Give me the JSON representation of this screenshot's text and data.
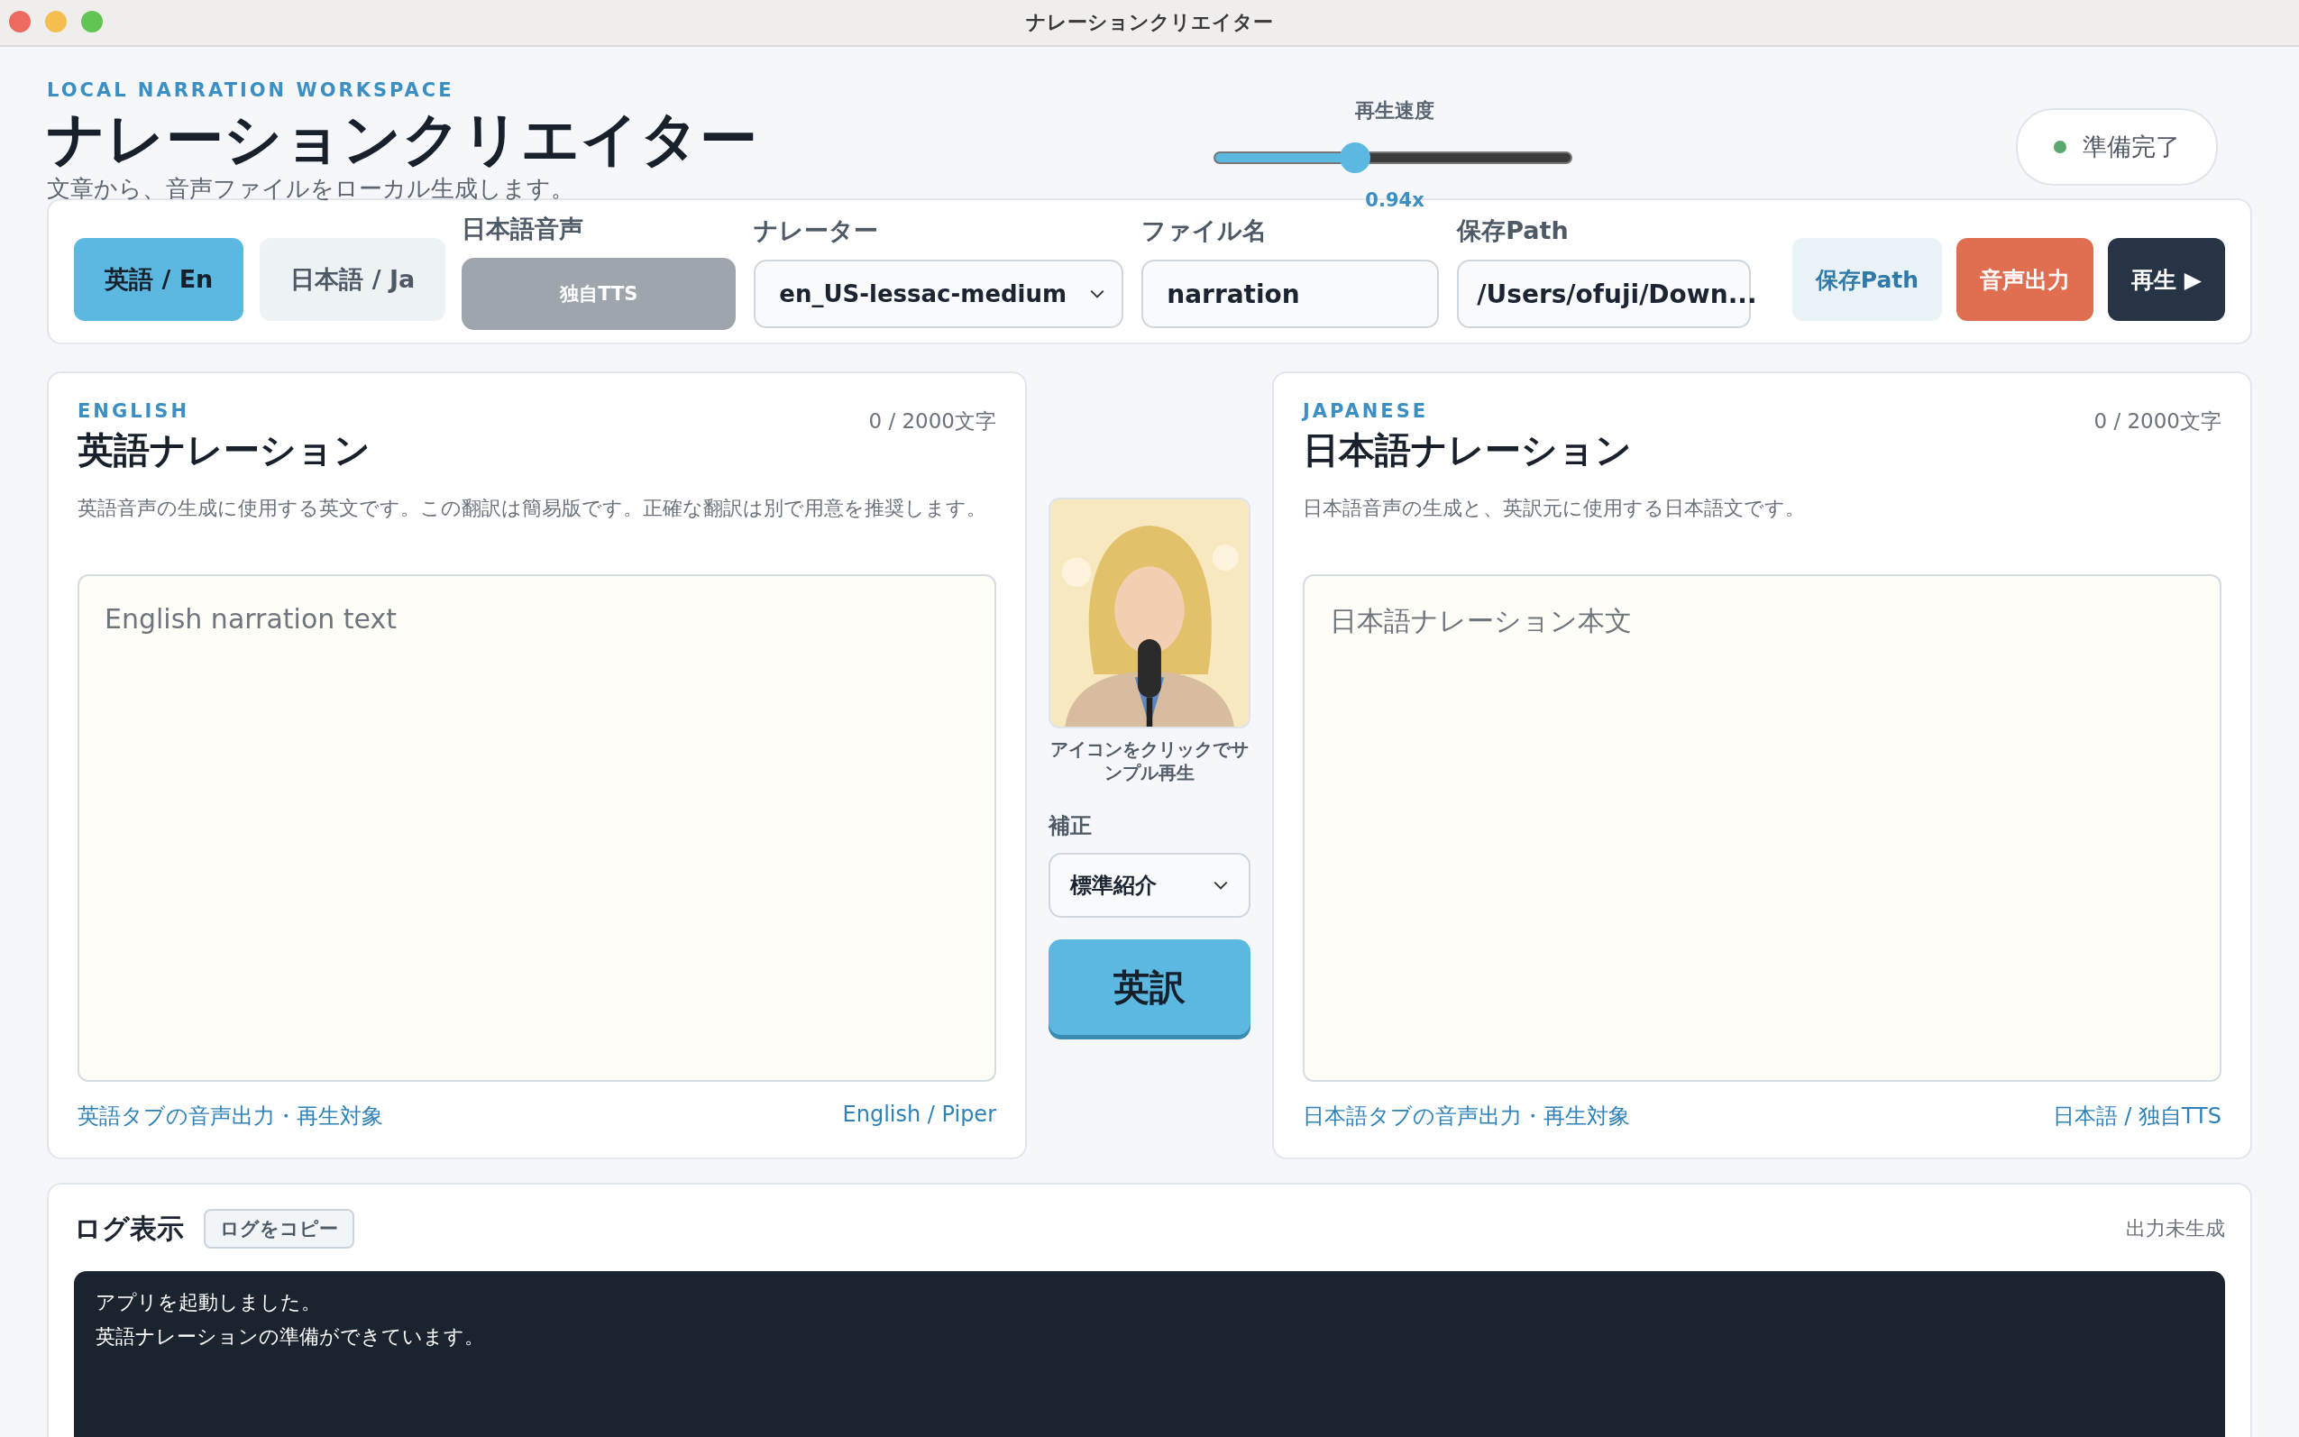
{
  "window": {
    "title": "ナレーションクリエイター"
  },
  "header": {
    "eyebrow": "LOCAL NARRATION WORKSPACE",
    "title": "ナレーションクリエイター",
    "subtitle": "文章から、音声ファイルをローカル生成します。"
  },
  "speed": {
    "label": "再生速度",
    "level": 0.39,
    "reading": "0.94x"
  },
  "status": {
    "text": "準備完了"
  },
  "toolbar": {
    "tabs": [
      {
        "label": "英語 / En",
        "selected": true
      },
      {
        "label": "日本語 / Ja",
        "selected": false
      }
    ],
    "japanese_voice": {
      "label": "日本語音声",
      "value": "独自TTS",
      "disabled": true
    },
    "narrator": {
      "label": "ナレーター",
      "value": "en_US-lessac-medium"
    },
    "filename": {
      "label": "ファイル名",
      "value": "narration"
    },
    "save_path": {
      "label": "保存Path",
      "value": "/Users/ofuji/Down..."
    },
    "buttons": [
      {
        "label": "保存Path",
        "kind": "secondary"
      },
      {
        "label": "音声出力",
        "kind": "accent"
      },
      {
        "label": "再生 ▶",
        "kind": "primary"
      }
    ]
  },
  "panels": [
    {
      "eyebrow": "ENGLISH",
      "title": "英語ナレーション",
      "count": "0 / 2000文字",
      "description": "英語音声の生成に使用する英文です。この翻訳は簡易版です。正確な翻訳は別で用意を推奨します。",
      "placeholder": "English narration text",
      "footer_left": "英語タブの音声出力・再生対象",
      "footer_right": "English / Piper"
    },
    {
      "eyebrow": "JAPANESE",
      "title": "日本語ナレーション",
      "count": "0 / 2000文字",
      "description": "日本語音声の生成と、英訳元に使用する日本語文です。",
      "placeholder": "日本語ナレーション本文",
      "footer_left": "日本語タブの音声出力・再生対象",
      "footer_right": "日本語 / 独自TTS"
    }
  ],
  "middle": {
    "caption": "アイコンをクリックでサンプル再生",
    "correction_label": "補正",
    "correction_value": "標準紹介",
    "translate_button": "英訳"
  },
  "log": {
    "title": "ログ表示",
    "copy_button": "ログをコピー",
    "status": "出力未生成",
    "lines": [
      "アプリを起動しました。",
      "英語ナレーションの準備ができています。"
    ]
  }
}
